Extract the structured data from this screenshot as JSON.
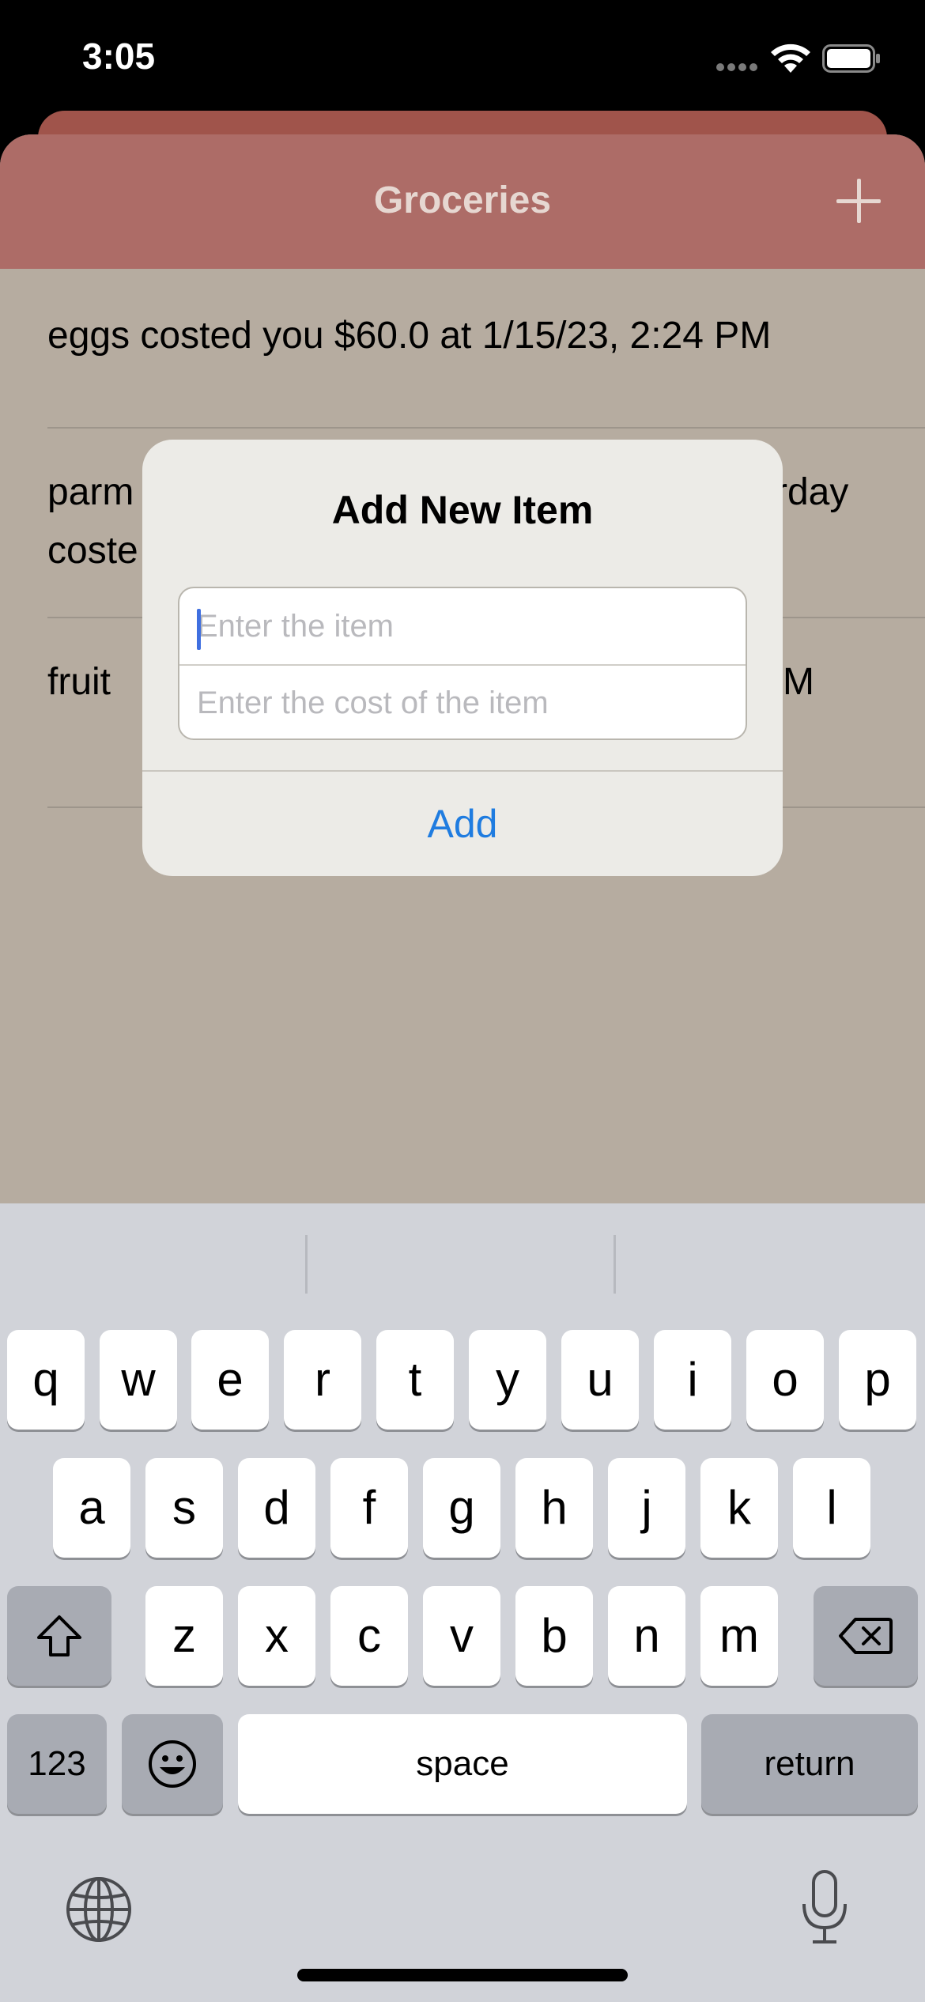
{
  "status_bar": {
    "time": "3:05"
  },
  "header": {
    "title": "Groceries"
  },
  "list": {
    "rows": [
      {
        "line1": "eggs costed you $60.0 at 1/15/23, 2:24 PM",
        "line2": ""
      },
      {
        "line1": "parm",
        "line1_right": "rday",
        "line2": "coste"
      },
      {
        "line1": "fruit",
        "line1_right": "M",
        "line2": ""
      }
    ]
  },
  "alert": {
    "title": "Add New Item",
    "item_placeholder": "Enter the item",
    "cost_placeholder": "Enter the cost of the item",
    "add_label": "Add"
  },
  "keyboard": {
    "row1": [
      "q",
      "w",
      "e",
      "r",
      "t",
      "y",
      "u",
      "i",
      "o",
      "p"
    ],
    "row2": [
      "a",
      "s",
      "d",
      "f",
      "g",
      "h",
      "j",
      "k",
      "l"
    ],
    "row3": [
      "z",
      "x",
      "c",
      "v",
      "b",
      "n",
      "m"
    ],
    "numbers_label": "123",
    "space_label": "space",
    "return_label": "return",
    "icons": [
      "shift-icon",
      "delete-icon",
      "emoji-icon",
      "globe-icon",
      "microphone-icon"
    ]
  }
}
